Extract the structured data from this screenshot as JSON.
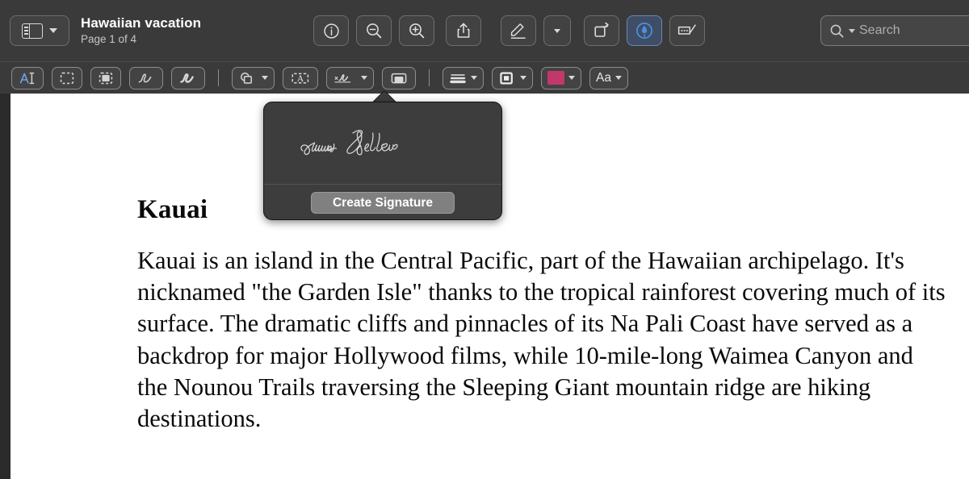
{
  "window": {
    "document_title": "Hawaiian vacation",
    "page_status": "Page 1 of 4"
  },
  "toolbar": {
    "sidebar_toggle": "sidebar-toggle",
    "buttons": [
      {
        "name": "info-icon",
        "label": "Info"
      },
      {
        "name": "zoom-out-icon",
        "label": "Zoom Out"
      },
      {
        "name": "zoom-in-icon",
        "label": "Zoom In"
      },
      {
        "name": "share-icon",
        "label": "Share"
      },
      {
        "name": "markup-pen-icon",
        "label": "Markup"
      },
      {
        "name": "markup-chevron-icon",
        "label": "Markup Options"
      },
      {
        "name": "rotate-icon",
        "label": "Rotate"
      },
      {
        "name": "highlight-icon",
        "label": "Highlight"
      },
      {
        "name": "annotate-icon",
        "label": "Annotate"
      }
    ]
  },
  "search": {
    "placeholder": "Search",
    "value": ""
  },
  "markup_toolbar": {
    "tools": [
      {
        "name": "text-select-tool",
        "label": "Text Selection"
      },
      {
        "name": "rect-select-tool",
        "label": "Rectangular Selection"
      },
      {
        "name": "instant-alpha-tool",
        "label": "Instant Alpha"
      },
      {
        "name": "sketch-tool",
        "label": "Sketch"
      },
      {
        "name": "draw-tool",
        "label": "Draw"
      },
      {
        "name": "shapes-tool",
        "label": "Shapes"
      },
      {
        "name": "text-box-tool",
        "label": "Text"
      },
      {
        "name": "signature-tool",
        "label": "Sign"
      },
      {
        "name": "note-tool",
        "label": "Note"
      },
      {
        "name": "line-style-tool",
        "label": "Shape Style"
      },
      {
        "name": "border-style-tool",
        "label": "Border Style"
      },
      {
        "name": "fill-color-tool",
        "label": "Fill Color"
      },
      {
        "name": "font-tool",
        "label": "Aa"
      }
    ],
    "font_label": "Aa",
    "fill_color": "#c2386b"
  },
  "signature_popover": {
    "signature_name": "Dennis Sellers",
    "create_button": "Create Signature"
  },
  "document": {
    "heading": "Kauai",
    "paragraph": "Kauai is an island in the Central Pacific, part of the Hawaiian archipelago. It's nicknamed \"the Garden Isle\" thanks to the tropical rainforest covering much of its surface. The dramatic cliffs and pinnacles of its Na Pali Coast have served as a backdrop for major Hollywood films, while 10-mile-long Waimea Canyon and the Nounou Trails traversing the Sleeping Giant mountain ridge are hiking destinations."
  },
  "colors": {
    "toolbar_bg": "#3a3a3a",
    "accent_blue": "#4d8fe0",
    "fill_swatch": "#c2386b"
  }
}
